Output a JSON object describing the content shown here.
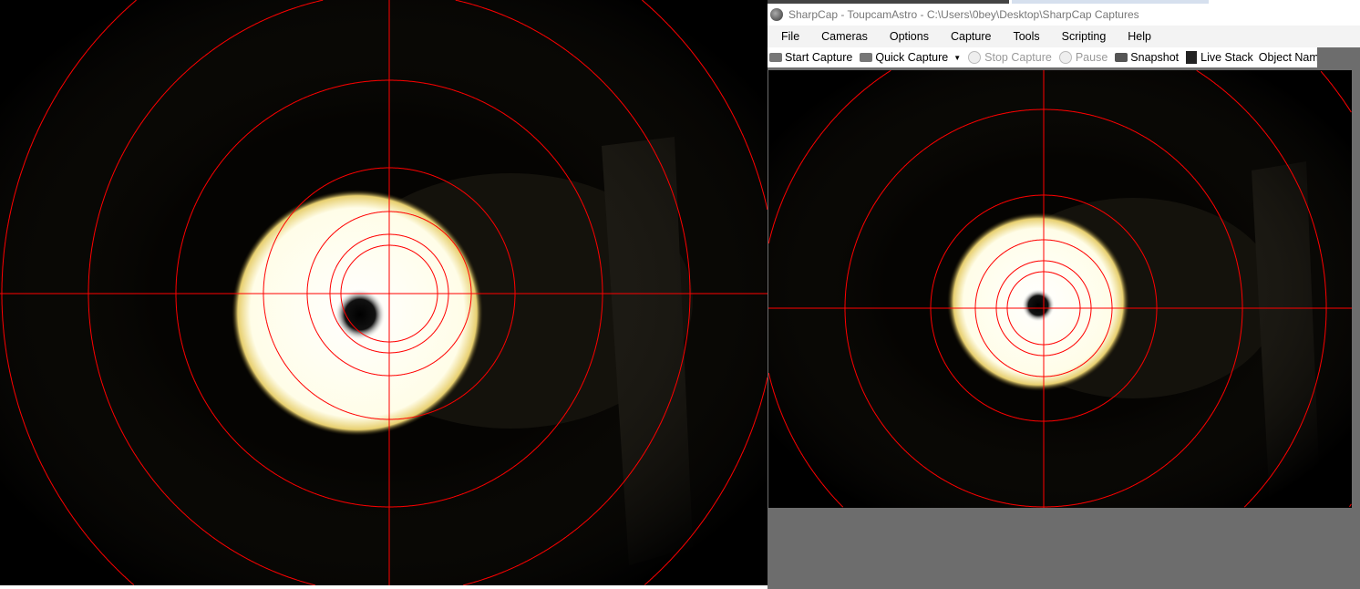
{
  "window": {
    "title": "SharpCap - ToupcamAstro - C:\\Users\\0bey\\Desktop\\SharpCap Captures"
  },
  "menu": [
    "File",
    "Cameras",
    "Options",
    "Capture",
    "Tools",
    "Scripting",
    "Help"
  ],
  "toolbar": {
    "start_capture": "Start Capture",
    "quick_capture": "Quick Capture",
    "stop_capture": "Stop Capture",
    "pause": "Pause",
    "snapshot": "Snapshot",
    "live_stack": "Live Stack",
    "object_name": "Object Name :"
  },
  "colors": {
    "reticle": "#ff0000",
    "background_gray": "#6d6d6d"
  }
}
